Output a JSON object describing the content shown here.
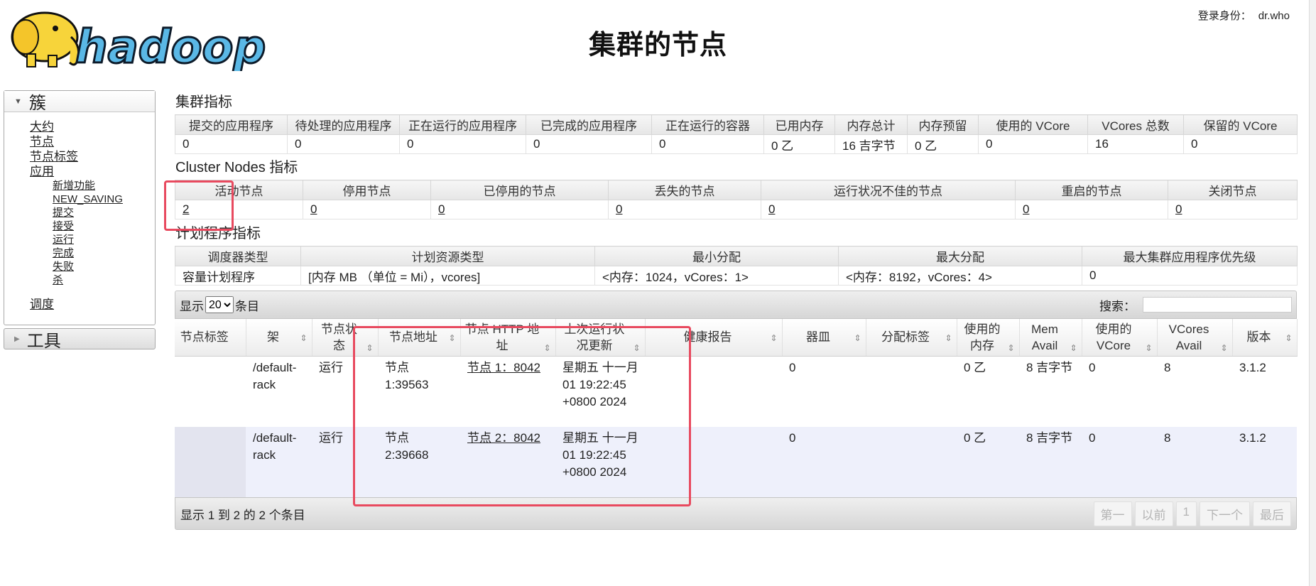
{
  "header": {
    "page_title": "集群的节点",
    "login_label": "登录身份：",
    "login_user": "dr.who",
    "logo_text": "hadoop"
  },
  "sidebar": {
    "cluster_section": "簇",
    "links": {
      "about": "大约",
      "nodes": "节点",
      "node_labels": "节点标签",
      "apps": "应用",
      "new": "新增功能",
      "new_saving": "NEW_SAVING",
      "submitted": "提交",
      "accepted": "接受",
      "running": "运行",
      "finished": "完成",
      "failed": "失败",
      "killed": "杀",
      "scheduler": "调度"
    },
    "tools_section": "工具"
  },
  "cluster_metrics": {
    "title": "集群指标",
    "headers": [
      "提交的应用程序",
      "待处理的应用程序",
      "正在运行的应用程序",
      "已完成的应用程序",
      "正在运行的容器",
      "已用内存",
      "内存总计",
      "内存预留",
      "使用的 VCore",
      "VCores 总数",
      "保留的 VCore"
    ],
    "values": [
      "0",
      "0",
      "0",
      "0",
      "0",
      "0 乙",
      "16 吉字节",
      "0 乙",
      "0",
      "16",
      "0"
    ]
  },
  "node_metrics": {
    "title": "Cluster Nodes 指标",
    "headers": [
      "活动节点",
      "停用节点",
      "已停用的节点",
      "丢失的节点",
      "运行状况不佳的节点",
      "重启的节点",
      "关闭节点"
    ],
    "values": [
      "2",
      "0",
      "0",
      "0",
      "0",
      "0",
      "0"
    ]
  },
  "scheduler_metrics": {
    "title": "计划程序指标",
    "headers": [
      "调度器类型",
      "计划资源类型",
      "最小分配",
      "最大分配",
      "最大集群应用程序优先级"
    ],
    "values": [
      "容量计划程序",
      "[内存 MB （单位 = Mi），vcores]",
      "<内存：1024，vCores：1>",
      "<内存：8192，vCores：4>",
      "0"
    ]
  },
  "nodes_table": {
    "show_label": "显示",
    "show_value": "20",
    "entries_label": "条目",
    "search_label": "搜索：",
    "search_value": "",
    "headers": [
      "节点标签",
      "架",
      "节点状态",
      "节点地址",
      "节点 HTTP 地址",
      "上次运行状况更新",
      "健康报告",
      "器皿",
      "分配标签",
      "使用的内存",
      "Mem Avail",
      "使用的 VCore",
      "VCores Avail",
      "版本"
    ],
    "rows": [
      {
        "label": "",
        "rack": "/default-rack",
        "state": "运行",
        "address": "节点 1:39563",
        "http": "节点 1：8042",
        "updated": "星期五 十一月 01 19:22:45 +0800 2024",
        "health": "",
        "containers": "0",
        "alloc_labels": "",
        "mem_used": "0 乙",
        "mem_avail": "8 吉字节",
        "vcore_used": "0",
        "vcore_avail": "8",
        "version": "3.1.2"
      },
      {
        "label": "",
        "rack": "/default-rack",
        "state": "运行",
        "address": "节点 2:39668",
        "http": "节点 2：8042",
        "updated": "星期五 十一月 01 19:22:45 +0800 2024",
        "health": "",
        "containers": "0",
        "alloc_labels": "",
        "mem_used": "0 乙",
        "mem_avail": "8 吉字节",
        "vcore_used": "0",
        "vcore_avail": "8",
        "version": "3.1.2"
      }
    ],
    "info": "显示 1 到 2 的 2 个条目",
    "pager": [
      "第一",
      "以前",
      "1",
      "下一个",
      "最后"
    ]
  },
  "colors": {
    "highlight": "#e84a5f",
    "logo_yellow": "#f7d43a",
    "logo_blue": "#5ab8e6"
  }
}
